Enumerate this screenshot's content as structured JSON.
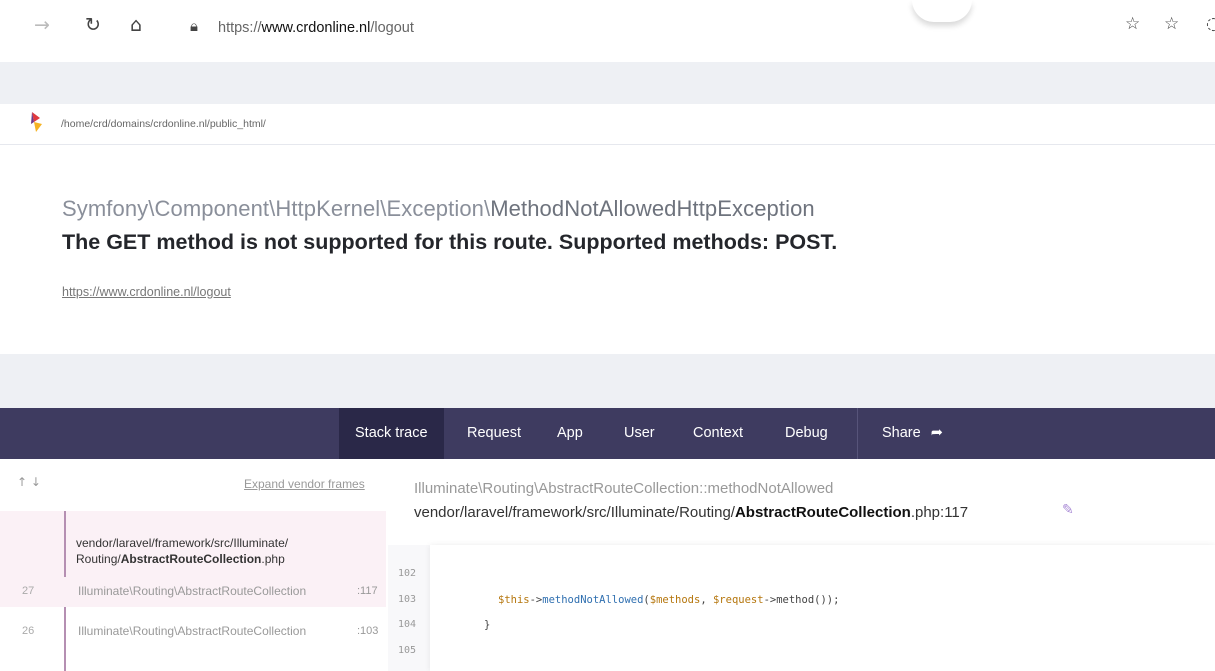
{
  "browser": {
    "url_prefix": "https://",
    "url_host": "www.crdonline.nl",
    "url_path": "/logout"
  },
  "path": "/home/crd/domains/crdonline.nl/public_html/",
  "exception": {
    "class_prefix": "Symfony\\Component\\HttpKernel\\Exception\\",
    "class_name": "MethodNotAllowedHttpException",
    "message": "The GET method is not supported for this route. Supported methods: POST.",
    "url": "https://www.crdonline.nl/logout"
  },
  "tabs": [
    "Stack trace",
    "Request",
    "App",
    "User",
    "Context",
    "Debug",
    "Share"
  ],
  "stack": {
    "expand_label": "Expand vendor frames",
    "selected_file_line1": "vendor/laravel/framework/src/Illuminate/",
    "selected_file_line2_prefix": "Routing/",
    "selected_file_line2_bold": "AbstractRouteCollection",
    "selected_file_line2_suffix": ".php",
    "frames": [
      {
        "num": "27",
        "cls": "Illuminate\\Routing\\AbstractRouteCollection",
        "line": ":117"
      },
      {
        "num": "26",
        "cls": "Illuminate\\Routing\\AbstractRouteCollection",
        "line": ":103"
      }
    ]
  },
  "code": {
    "method_ref": "Illuminate\\Routing\\AbstractRouteCollection::methodNotAllowed",
    "file_prefix": "vendor/laravel/framework/src/Illuminate/Routing/",
    "file_bold": "AbstractRouteCollection",
    "file_suffix": ".php:117",
    "lines": [
      "102",
      "103",
      "104",
      "105"
    ],
    "line103_var": "$this",
    "line103_arrow": "->",
    "line103_fn": "methodNotAllowed",
    "line103_args_a": "(",
    "line103_arg1": "$methods",
    "line103_comma": ", ",
    "line103_arg2": "$request",
    "line103_tail": "->method());",
    "line104": "}"
  }
}
